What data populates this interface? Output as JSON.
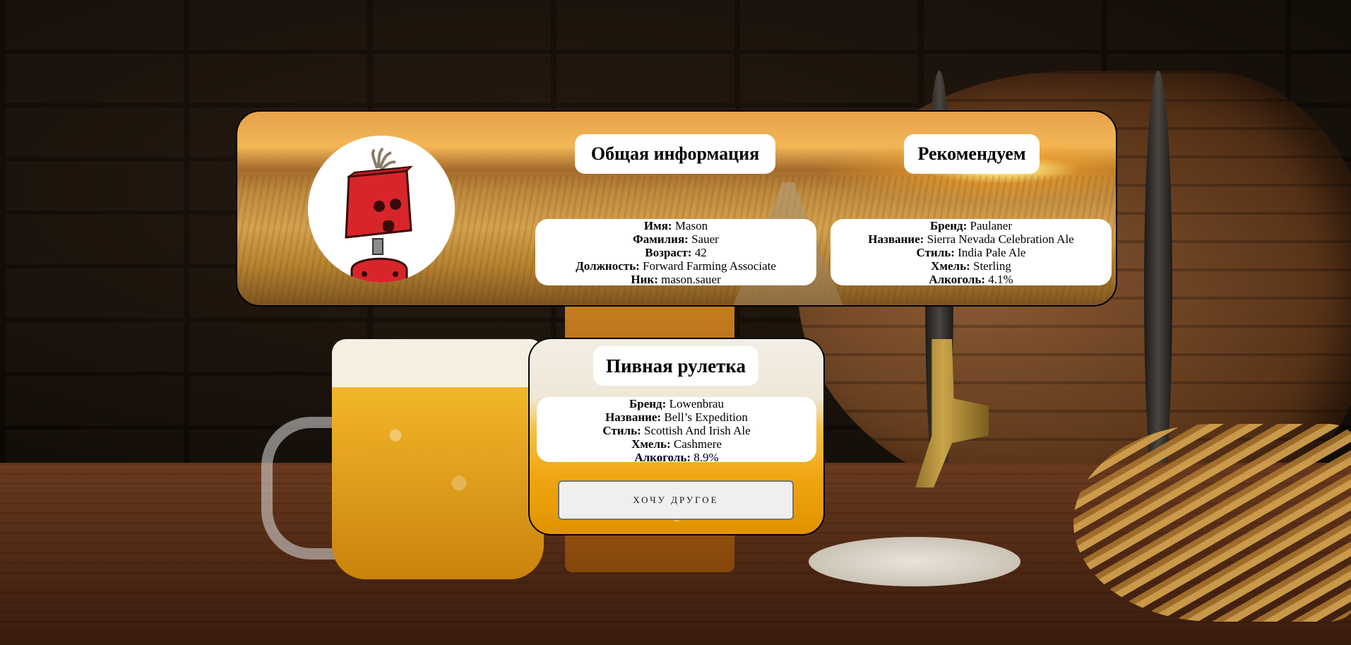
{
  "profile": {
    "general_title": "Общая информация",
    "recommend_title": "Рекомендуем",
    "fields": [
      {
        "label": "Имя:",
        "value": "Mason"
      },
      {
        "label": "Фамилия:",
        "value": "Sauer"
      },
      {
        "label": "Возраст:",
        "value": "42"
      },
      {
        "label": "Должность:",
        "value": "Forward Farming Associate"
      },
      {
        "label": "Ник:",
        "value": "mason.sauer"
      }
    ],
    "recommended": [
      {
        "label": "Бренд:",
        "value": "Paulaner"
      },
      {
        "label": "Название:",
        "value": "Sierra Nevada Celebration Ale"
      },
      {
        "label": "Стиль:",
        "value": "India Pale Ale"
      },
      {
        "label": "Хмель:",
        "value": "Sterling"
      },
      {
        "label": "Алкоголь:",
        "value": "4.1%"
      }
    ]
  },
  "roulette": {
    "title": "Пивная рулетка",
    "beer": [
      {
        "label": "Бренд:",
        "value": "Lowenbrau"
      },
      {
        "label": "Название:",
        "value": "Bell’s Expedition"
      },
      {
        "label": "Стиль:",
        "value": "Scottish And Irish Ale"
      },
      {
        "label": "Хмель:",
        "value": "Cashmere"
      },
      {
        "label": "Алкоголь:",
        "value": "8.9%"
      }
    ],
    "button_label": "ХОЧУ ДРУГОЕ"
  },
  "avatar_icon": "robot-icon",
  "colors": {
    "robot_red": "#d8252b",
    "card_border": "#000000",
    "button_bg": "#efefef"
  }
}
